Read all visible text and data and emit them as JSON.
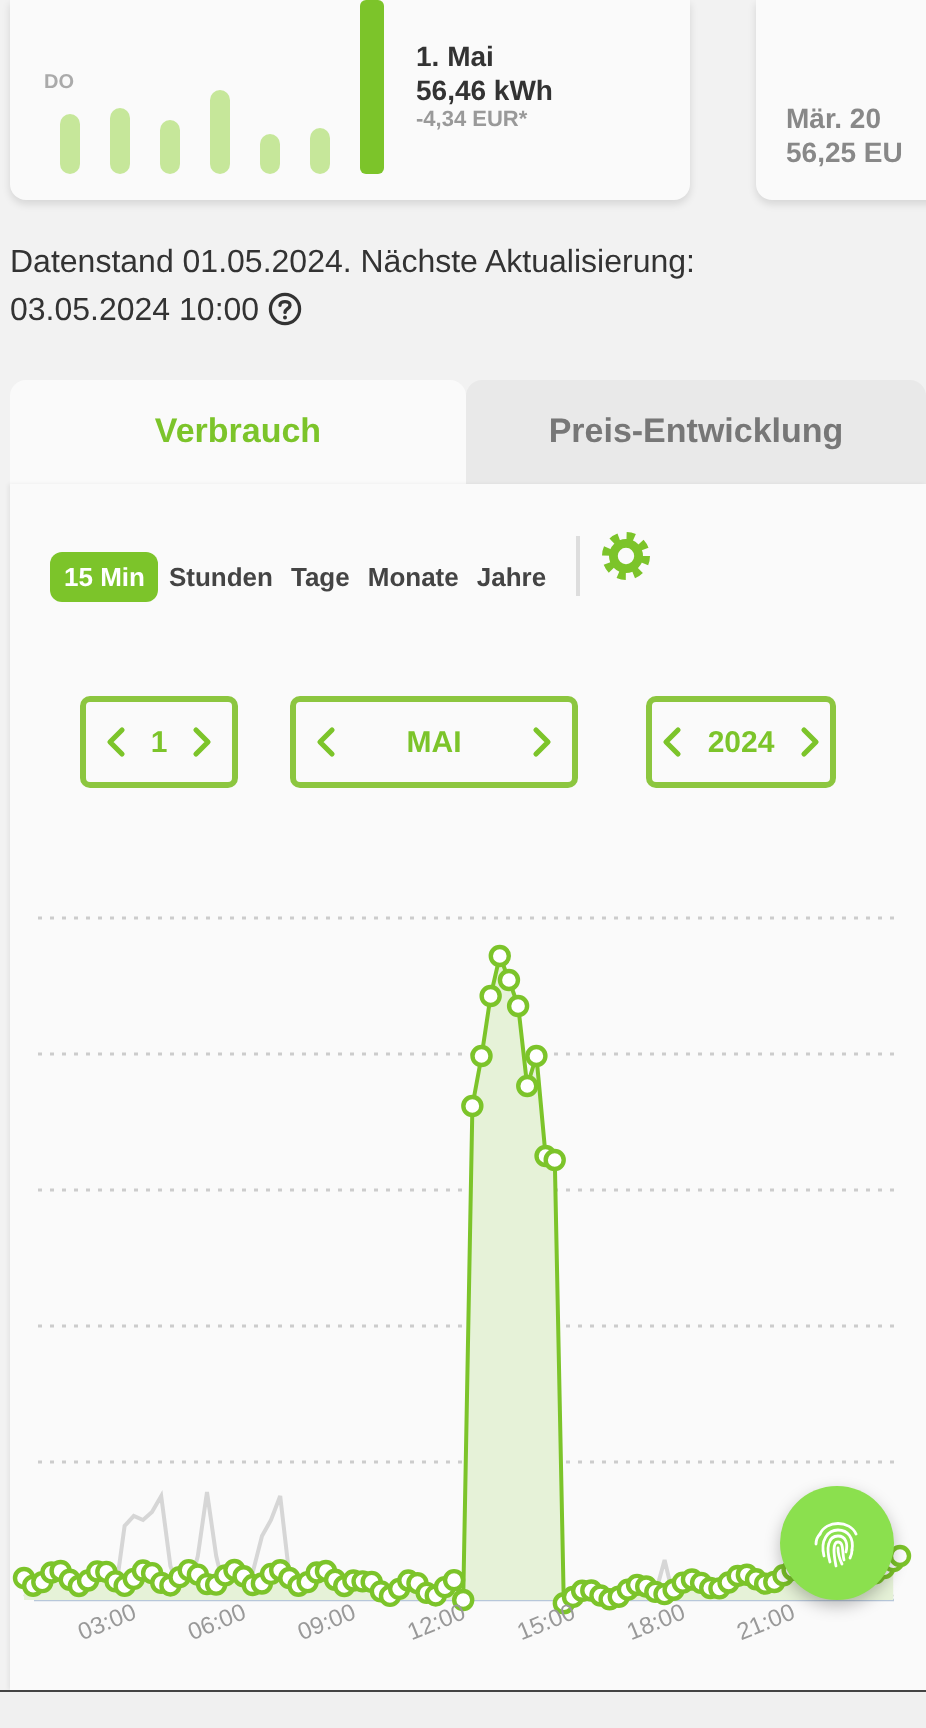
{
  "summary_cards": [
    {
      "day_label": "DO",
      "title": "1. Mai",
      "value": "56,46 kWh",
      "cost": "-4,34 EUR*"
    },
    {
      "title": "Mär. 20",
      "value": "56,25 EU"
    }
  ],
  "status_lines": [
    "Datenstand 01.05.2024. Nächste Aktualisierung:",
    "03.05.2024 10:00"
  ],
  "tabs": [
    {
      "label": "Verbrauch",
      "selected": true
    },
    {
      "label": "Preis-Entwicklung",
      "selected": false
    }
  ],
  "periods": [
    {
      "label": "15 Min",
      "selected": true
    },
    {
      "label": "Stunden",
      "selected": false
    },
    {
      "label": "Tage",
      "selected": false
    },
    {
      "label": "Monate",
      "selected": false
    },
    {
      "label": "Jahre",
      "selected": false
    }
  ],
  "navigators": [
    {
      "kind": "day",
      "value": "1"
    },
    {
      "kind": "month",
      "value": "MAI"
    },
    {
      "kind": "year",
      "value": "2024"
    }
  ],
  "chart": {
    "x_labels": [
      "03:00",
      "06:00",
      "09:00",
      "12:00",
      "15:00",
      "18:00",
      "21:00"
    ]
  }
}
